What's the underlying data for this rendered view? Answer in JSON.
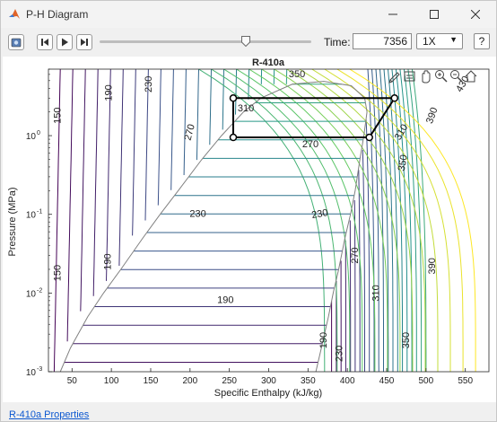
{
  "window": {
    "title": "P-H Diagram",
    "controls": [
      "minimize",
      "maximize",
      "close"
    ]
  },
  "toolbar": {
    "buttons": [
      {
        "icon": "snapshot-icon"
      },
      {
        "icon": "step-back-icon"
      },
      {
        "icon": "play-icon"
      },
      {
        "icon": "step-forward-icon"
      }
    ],
    "slider_fraction": 0.69,
    "time_label": "Time:",
    "time_value": "7356",
    "speed_value": "1X",
    "help_label": "?"
  },
  "plot": {
    "title": "R-410a",
    "xlabel": "Specific Enthalpy (kJ/kg)",
    "ylabel": "Pressure (MPa)",
    "axes_toolbar": [
      "edit-icon",
      "datatip-icon",
      "pan-icon",
      "zoom-in-icon",
      "zoom-out-icon",
      "home-icon"
    ]
  },
  "chart_data": {
    "type": "line",
    "title": "R-410a",
    "xlabel": "Specific Enthalpy (kJ/kg)",
    "ylabel": "Pressure (MPa)",
    "xlim": [
      20,
      580
    ],
    "ylim": [
      0.001,
      7
    ],
    "yscale": "log",
    "xticks": [
      "50",
      "100",
      "150",
      "200",
      "250",
      "300",
      "350",
      "400",
      "450",
      "500",
      "550"
    ],
    "yticks": [
      {
        "value": 1,
        "base": "10",
        "exp": "0"
      },
      {
        "value": 0.1,
        "base": "10",
        "exp": "-1"
      },
      {
        "value": 0.01,
        "base": "10",
        "exp": "-2"
      },
      {
        "value": 0.001,
        "base": "10",
        "exp": "-3"
      }
    ],
    "saturation_dome": {
      "liquid": [
        [
          35,
          0.001
        ],
        [
          48,
          0.002
        ],
        [
          70,
          0.005
        ],
        [
          90,
          0.01
        ],
        [
          112,
          0.02
        ],
        [
          140,
          0.05
        ],
        [
          162,
          0.1
        ],
        [
          185,
          0.2
        ],
        [
          215,
          0.5
        ],
        [
          240,
          1.0
        ],
        [
          268,
          2.0
        ],
        [
          290,
          3.0
        ],
        [
          330,
          4.5
        ],
        [
          370,
          4.9
        ]
      ],
      "vapor": [
        [
          360,
          0.001
        ],
        [
          367,
          0.002
        ],
        [
          376,
          0.005
        ],
        [
          382,
          0.01
        ],
        [
          389,
          0.02
        ],
        [
          397,
          0.05
        ],
        [
          404,
          0.1
        ],
        [
          410,
          0.2
        ],
        [
          416,
          0.5
        ],
        [
          421,
          1.0
        ],
        [
          425,
          2.0
        ],
        [
          422,
          3.0
        ],
        [
          405,
          4.3
        ],
        [
          370,
          4.9
        ]
      ]
    },
    "isotherm_labels": [
      {
        "text": "150",
        "x": 32,
        "p": 1.8,
        "rot": -90
      },
      {
        "text": "190",
        "x": 97,
        "p": 3.5,
        "rot": -90
      },
      {
        "text": "230",
        "x": 148,
        "p": 4.5,
        "rot": -90
      },
      {
        "text": "270",
        "x": 200,
        "p": 1.1,
        "rot": -75
      },
      {
        "text": "310",
        "x": 271,
        "p": 2.2,
        "rot": 0
      },
      {
        "text": "350",
        "x": 336,
        "p": 6.0,
        "rot": 0
      },
      {
        "text": "430",
        "x": 547,
        "p": 4.5,
        "rot": -60
      },
      {
        "text": "390",
        "x": 508,
        "p": 1.8,
        "rot": -70
      },
      {
        "text": "310",
        "x": 469,
        "p": 1.1,
        "rot": -60
      },
      {
        "text": "270",
        "x": 353,
        "p": 0.77,
        "rot": 0
      },
      {
        "text": "350",
        "x": 471,
        "p": 0.45,
        "rot": -80
      },
      {
        "text": "230",
        "x": 210,
        "p": 0.1,
        "rot": 0
      },
      {
        "text": "230",
        "x": 365,
        "p": 0.1,
        "rot": -10
      },
      {
        "text": "190",
        "x": 96,
        "p": 0.025,
        "rot": -90
      },
      {
        "text": "150",
        "x": 32,
        "p": 0.018,
        "rot": -90
      },
      {
        "text": "270",
        "x": 410,
        "p": 0.03,
        "rot": -90
      },
      {
        "text": "310",
        "x": 437,
        "p": 0.01,
        "rot": -90
      },
      {
        "text": "390",
        "x": 508,
        "p": 0.022,
        "rot": -90
      },
      {
        "text": "190",
        "x": 245,
        "p": 0.008,
        "rot": 0
      },
      {
        "text": "190",
        "x": 370,
        "p": 0.0025,
        "rot": -90
      },
      {
        "text": "350",
        "x": 475,
        "p": 0.0025,
        "rot": -90
      },
      {
        "text": "230",
        "x": 390,
        "p": 0.0017,
        "rot": -90
      }
    ],
    "cycle": {
      "points": [
        [
          255,
          3.0
        ],
        [
          460,
          3.0
        ],
        [
          428,
          0.95
        ],
        [
          255,
          0.95
        ]
      ],
      "color": "#000000"
    },
    "colors": [
      "#440154",
      "#3b528b",
      "#21918c",
      "#5ec962",
      "#fde725"
    ]
  },
  "footer": {
    "link": "R-410a Properties"
  }
}
